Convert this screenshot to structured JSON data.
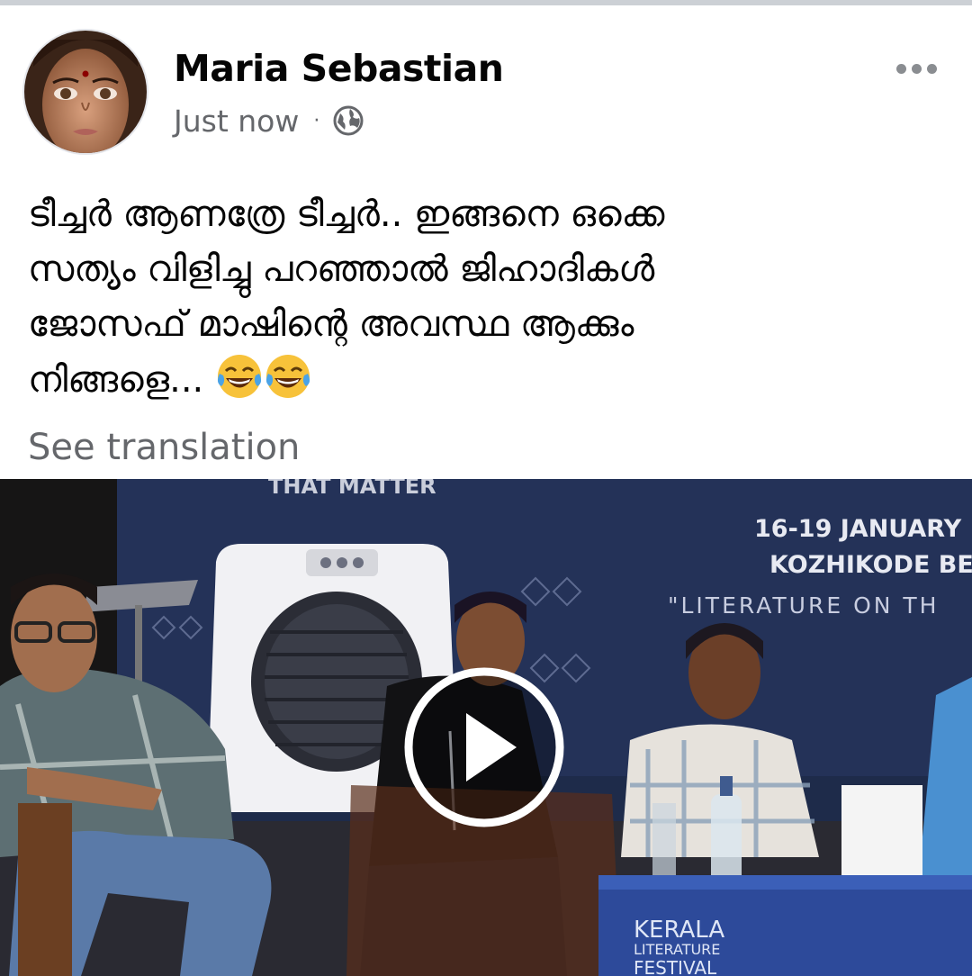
{
  "post": {
    "author": "Maria Sebastian",
    "timestamp": "Just now",
    "separator": "·",
    "privacy_icon": "globe-icon",
    "text_lines": [
      "ടീച്ചർ ആണത്രേ ടീച്ചർ.. ഇങ്ങനെ ഒക്കെ",
      "സത്യം വിളിച്ചു പറഞ്ഞാൽ ജിഹാദികൾ",
      "ജോസഫ് മാഷിന്റെ അവസ്ഥ ആക്കും",
      "നിങ്ങളെ..."
    ],
    "emojis": [
      "😂",
      "😂"
    ],
    "see_translation": "See translation"
  },
  "video": {
    "banner_top": "THAT MATTER",
    "banner_dates": "16-19 JANUARY",
    "banner_location": "KOZHIKODE BE",
    "banner_tagline": "\"LITERATURE ON TH",
    "festival_lines": [
      "KERALA",
      "LITERATURE",
      "FESTIVAL"
    ],
    "play_icon": "play-icon"
  },
  "colors": {
    "name": "#050505",
    "secondary": "#65676b",
    "video_backdrop": "#1e2b4a"
  }
}
